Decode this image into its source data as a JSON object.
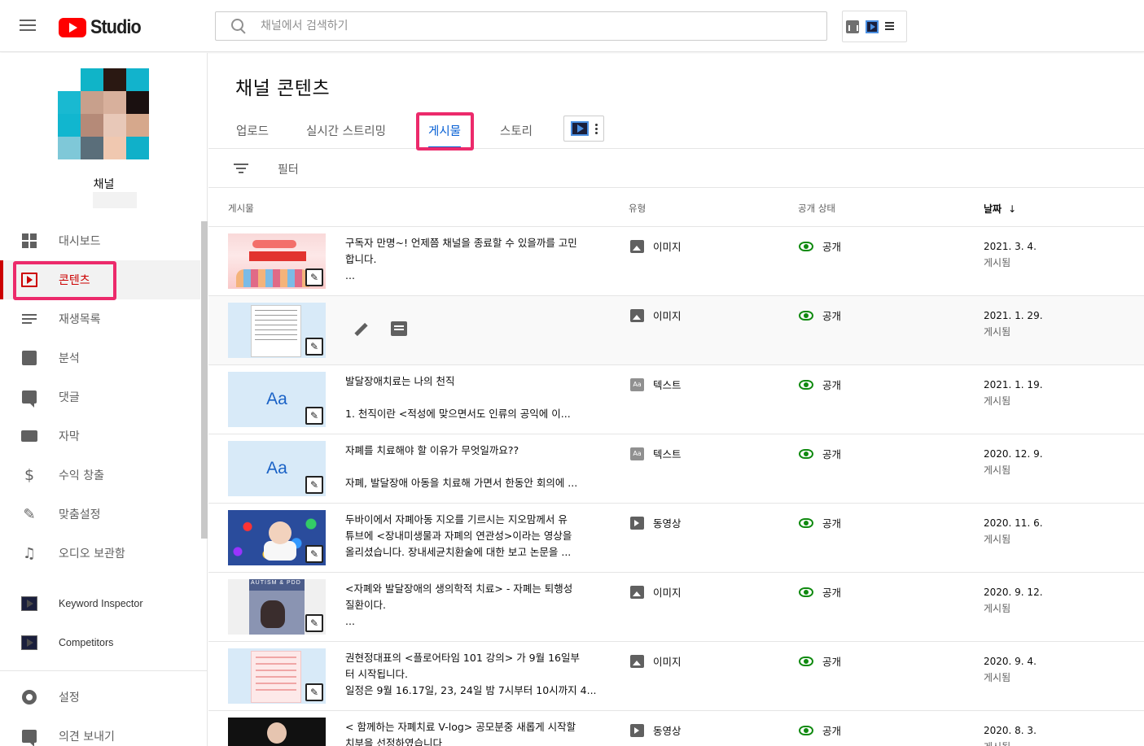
{
  "header": {
    "logo_text": "Studio",
    "search_placeholder": "채널에서 검색하기"
  },
  "sidebar": {
    "channel_name": "채널",
    "items": [
      {
        "label": "대시보드",
        "icon": "dashboard-icon"
      },
      {
        "label": "콘텐츠",
        "icon": "content-icon",
        "active": true
      },
      {
        "label": "재생목록",
        "icon": "playlist-icon"
      },
      {
        "label": "분석",
        "icon": "analytics-icon"
      },
      {
        "label": "댓글",
        "icon": "comment-icon"
      },
      {
        "label": "자막",
        "icon": "subtitles-icon"
      },
      {
        "label": "수익 창출",
        "icon": "dollar-icon"
      },
      {
        "label": "맞춤설정",
        "icon": "magic-wand-icon"
      },
      {
        "label": "오디오 보관함",
        "icon": "audio-library-icon"
      }
    ],
    "ext_items": [
      {
        "label": "Keyword Inspector",
        "icon": "vidiq-icon"
      },
      {
        "label": "Competitors",
        "icon": "vidiq-icon"
      }
    ],
    "bottom_items": [
      {
        "label": "설정",
        "icon": "gear-icon"
      },
      {
        "label": "의견 보내기",
        "icon": "feedback-icon"
      }
    ]
  },
  "main": {
    "title": "채널 콘텐츠",
    "tabs": [
      {
        "label": "업로드"
      },
      {
        "label": "실시간 스트리밍"
      },
      {
        "label": "게시물",
        "active": true
      },
      {
        "label": "스토리"
      }
    ],
    "filter_label": "필터",
    "columns": {
      "post": "게시물",
      "type": "유형",
      "visibility": "공개 상태",
      "date": "날짜",
      "sort_arrow": "↓"
    },
    "rows": [
      {
        "line1": "구독자 만명~! 언제쯤 채널을 종료할 수 있을까를 고민",
        "line2": "합니다.",
        "line3": "...",
        "type": "이미지",
        "type_icon": "image-icon",
        "visibility": "공개",
        "date": "2021. 3. 4.",
        "status": "게시됨"
      },
      {
        "line1": "",
        "line2": "",
        "line3": "",
        "type": "이미지",
        "type_icon": "image-icon",
        "visibility": "공개",
        "date": "2021. 1. 29.",
        "status": "게시됨",
        "hover": true
      },
      {
        "line1": "발달장애치료는 나의 천직",
        "line2": "",
        "line3": "1.  천직이란 <적성에 맞으면서도 인류의 공익에 이...",
        "type": "텍스트",
        "type_icon": "text-icon",
        "visibility": "공개",
        "date": "2021. 1. 19.",
        "status": "게시됨",
        "thumb_text": "Aa"
      },
      {
        "line1": "자폐를 치료해야 할 이유가 무엇일까요??",
        "line2": "",
        "line3": "자폐, 발달장애 아동을 치료해 가면서 한동안 회의에 ...",
        "type": "텍스트",
        "type_icon": "text-icon",
        "visibility": "공개",
        "date": "2020. 12. 9.",
        "status": "게시됨",
        "thumb_text": "Aa"
      },
      {
        "line1": "두바이에서 자폐아동 지오를 기르시는 지오맘께서 유",
        "line2": "튜브에 <장내미생물과 자폐의 연관성>이라는 영상을",
        "line3": "올리셨습니다.  장내세균치환술에 대한 보고 논문을 ...",
        "type": "동영상",
        "type_icon": "video-icon",
        "visibility": "공개",
        "date": "2020. 11. 6.",
        "status": "게시됨"
      },
      {
        "line1": "<자폐와 발달장애의 생의학적 치료> - 자폐는 퇴행성",
        "line2": "질환이다.",
        "line3": "...",
        "type": "이미지",
        "type_icon": "image-icon",
        "visibility": "공개",
        "date": "2020. 9. 12.",
        "status": "게시됨",
        "thumb_text": "AUTISM & PDD"
      },
      {
        "line1": "권현정대표의 <플로어타임 101 강의> 가 9월 16일부",
        "line2": "터 시작됩니다.",
        "line3": "일정은 9월 16.17일, 23, 24일 밤 7시부터 10시까지 4...",
        "type": "이미지",
        "type_icon": "image-icon",
        "visibility": "공개",
        "date": "2020. 9. 4.",
        "status": "게시됨"
      },
      {
        "line1": "< 함께하는 자폐치료 V-log> 공모분중 새롭게 시작할",
        "line2": "치부을 선정하였습니다",
        "line3": "",
        "type": "동영상",
        "type_icon": "video-icon",
        "visibility": "공개",
        "date": "2020. 8. 3.",
        "status": "게시됨"
      }
    ]
  },
  "colors": {
    "accent_red": "#cc0000",
    "highlight_pink": "#ec2a6b",
    "tab_active_blue": "#065fd4",
    "public_green": "#0f8a0f"
  }
}
